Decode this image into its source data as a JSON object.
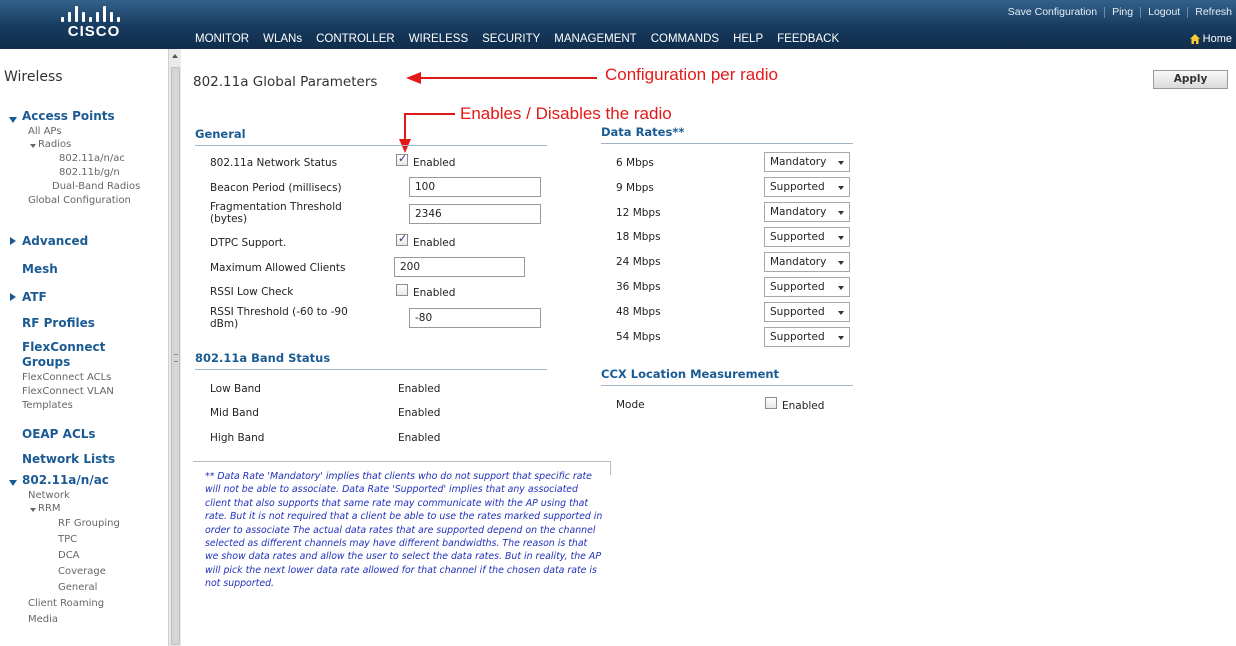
{
  "brand": {
    "logo_text": "CISCO"
  },
  "nav": {
    "items": [
      "MONITOR",
      "WLANs",
      "CONTROLLER",
      "WIRELESS",
      "SECURITY",
      "MANAGEMENT",
      "COMMANDS",
      "HELP",
      "FEEDBACK"
    ],
    "active": "WIRELESS"
  },
  "util": {
    "save": "Save Configuration",
    "ping": "Ping",
    "logout": "Logout",
    "refresh": "Refresh",
    "home": "Home"
  },
  "sidebar": {
    "title": "Wireless",
    "access_points": "Access Points",
    "all_aps": "All APs",
    "radios": "Radios",
    "radio_a": "802.11a/n/ac",
    "radio_b": "802.11b/g/n",
    "dual_band": "Dual-Band Radios",
    "global_config": "Global Configuration",
    "advanced": "Advanced",
    "mesh": "Mesh",
    "atf": "ATF",
    "rf_profiles": "RF Profiles",
    "flexconnect_1": "FlexConnect",
    "flexconnect_2": "Groups",
    "flex_acls": "FlexConnect ACLs",
    "flex_vlan_1": "FlexConnect VLAN",
    "flex_vlan_2": "Templates",
    "oeap": "OEAP ACLs",
    "network_lists": "Network Lists",
    "band_section": "802.11a/n/ac",
    "network": "Network",
    "rrm": "RRM",
    "rf_grouping": "RF Grouping",
    "tpc": "TPC",
    "dca": "DCA",
    "coverage": "Coverage",
    "general": "General",
    "client_roaming": "Client Roaming",
    "media": "Media"
  },
  "page": {
    "title": "802.11a Global Parameters",
    "apply": "Apply"
  },
  "annotations": {
    "config": "Configuration  per radio",
    "enables": "Enables / Disables the radio"
  },
  "general": {
    "header": "General",
    "network_status_label": "802.11a Network Status",
    "network_status_checked": true,
    "network_status_text": "Enabled",
    "beacon_label": "Beacon Period (millisecs)",
    "beacon_value": "100",
    "frag_label_1": "Fragmentation Threshold",
    "frag_label_2": "(bytes)",
    "frag_value": "2346",
    "dtpc_label": "DTPC Support.",
    "dtpc_checked": true,
    "dtpc_text": "Enabled",
    "max_clients_label": "Maximum Allowed Clients",
    "max_clients_value": "200",
    "rssi_check_label": "RSSI Low Check",
    "rssi_check_checked": false,
    "rssi_check_text": "Enabled",
    "rssi_thresh_label_1": "RSSI Threshold (-60 to -90",
    "rssi_thresh_label_2": "dBm)",
    "rssi_thresh_value": "-80"
  },
  "band_status": {
    "header": "802.11a Band Status",
    "rows": [
      {
        "label": "Low Band",
        "value": "Enabled"
      },
      {
        "label": "Mid Band",
        "value": "Enabled"
      },
      {
        "label": "High Band",
        "value": "Enabled"
      }
    ]
  },
  "data_rates": {
    "header": "Data Rates**",
    "rows": [
      {
        "rate": "6 Mbps",
        "value": "Mandatory"
      },
      {
        "rate": "9 Mbps",
        "value": "Supported"
      },
      {
        "rate": "12 Mbps",
        "value": "Mandatory"
      },
      {
        "rate": "18 Mbps",
        "value": "Supported"
      },
      {
        "rate": "24 Mbps",
        "value": "Mandatory"
      },
      {
        "rate": "36 Mbps",
        "value": "Supported"
      },
      {
        "rate": "48 Mbps",
        "value": "Supported"
      },
      {
        "rate": "54 Mbps",
        "value": "Supported"
      }
    ]
  },
  "ccx": {
    "header": "CCX Location Measurement",
    "mode_label": "Mode",
    "mode_checked": false,
    "mode_text": "Enabled"
  },
  "footnote": "** Data Rate 'Mandatory' implies that clients who do not support that specific rate will not be able to associate. Data Rate 'Supported' implies that any associated client that also supports that same rate may communicate with the AP using that rate. But it is not required that a client be able to use the rates marked supported in order to associate The actual data rates that are supported depend on the channel selected as different channels may have different bandwidths. The reason is that we show data rates and allow the user to select the data rates. But in reality, the AP will pick the next lower data rate allowed for that channel if the chosen data rate is not supported.",
  "colors": {
    "annotation": "#e31919",
    "section_head": "#1b5b93",
    "footnote": "#2233bb"
  },
  "icons": [
    "cisco-logo-icon",
    "home-icon",
    "checkbox-icon",
    "dropdown-arrow-icon",
    "collapse-triangle-icon",
    "expand-triangle-icon",
    "annotation-arrow-icon"
  ]
}
